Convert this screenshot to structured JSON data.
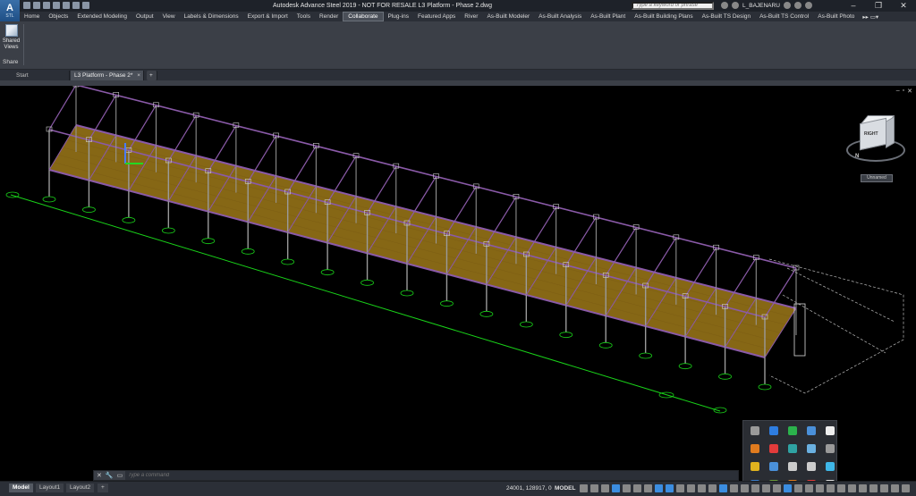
{
  "app": {
    "logo_letter": "A",
    "logo_sub": "STL",
    "title": "Autodesk Advance Steel 2019 - NOT FOR RESALE    L3 Platform - Phase 2.dwg",
    "search_placeholder": "Type a keyword or phrase",
    "user_name": "L_BAJENARU"
  },
  "ribbon_tabs": [
    "Home",
    "Objects",
    "Extended Modeling",
    "Output",
    "View",
    "Labels & Dimensions",
    "Export & Import",
    "Tools",
    "Render",
    "Collaborate",
    "Plug-ins",
    "Featured Apps",
    "River",
    "As-Built Modeler",
    "As-Built Analysis",
    "As-Built Plant",
    "As-Built Building Plans",
    "As-Built TS Design",
    "As-Built TS Control",
    "As-Built Photo"
  ],
  "active_tab": "Collaborate",
  "ribbon_panel": {
    "button_label": "Shared Views",
    "panel_title": "Share"
  },
  "file_tabs": {
    "start": "Start",
    "document": "L3 Platform - Phase 2*"
  },
  "viewcube": {
    "face_label": "RIGHT",
    "compass_letter": "N",
    "ucs_label": "Unnamed"
  },
  "command_line": {
    "placeholder": "Type a command"
  },
  "status_bar": {
    "layout_tabs": [
      "Model",
      "Layout1",
      "Layout2"
    ],
    "coordinates": "24001, 128917, 0",
    "space": "MODEL"
  },
  "colors": {
    "grid_green": "#19d219",
    "beam_purple": "#8a5aa8",
    "deck_yellow": "#b38a1c",
    "column_gray": "#9a9a9a"
  }
}
